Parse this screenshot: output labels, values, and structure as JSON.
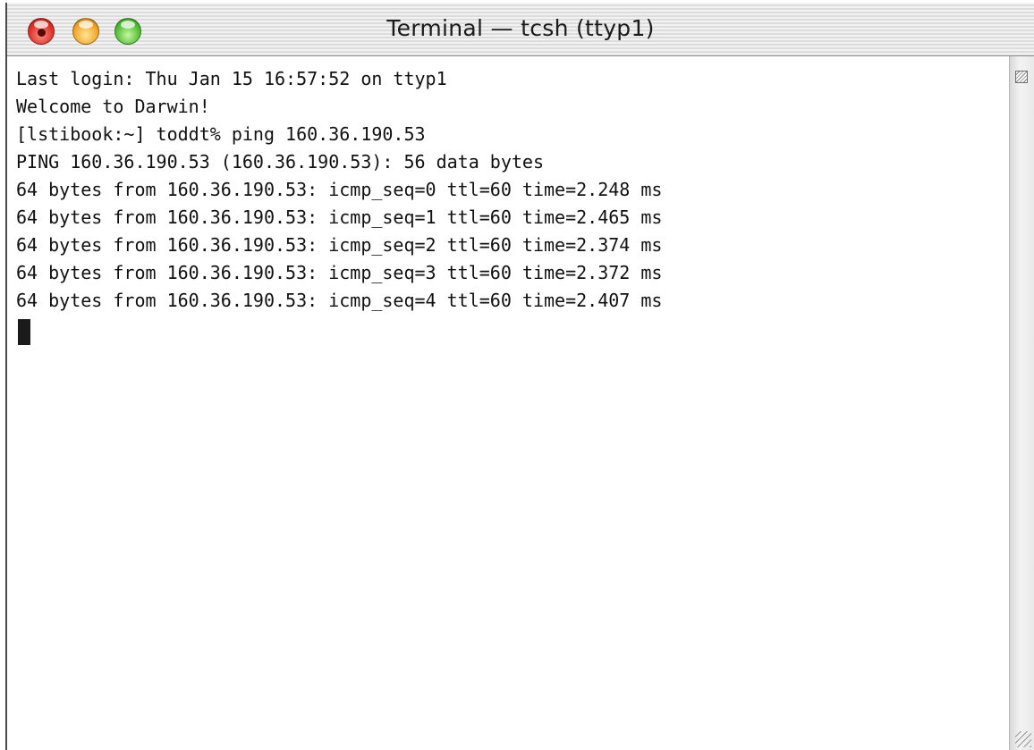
{
  "window": {
    "title": "Terminal — tcsh (ttyp1)"
  },
  "terminal": {
    "lines": [
      "Last login: Thu Jan 15 16:57:52 on ttyp1",
      "Welcome to Darwin!",
      "[lstibook:~] toddt% ping 160.36.190.53",
      "PING 160.36.190.53 (160.36.190.53): 56 data bytes",
      "64 bytes from 160.36.190.53: icmp_seq=0 ttl=60 time=2.248 ms",
      "64 bytes from 160.36.190.53: icmp_seq=1 ttl=60 time=2.465 ms",
      "64 bytes from 160.36.190.53: icmp_seq=2 ttl=60 time=2.374 ms",
      "64 bytes from 160.36.190.53: icmp_seq=3 ttl=60 time=2.372 ms",
      "64 bytes from 160.36.190.53: icmp_seq=4 ttl=60 time=2.407 ms"
    ]
  },
  "icons": {
    "close": "close-icon",
    "minimize": "minimize-icon",
    "zoom": "zoom-icon",
    "splitter": "split-pane-icon",
    "resize": "resize-grip-icon"
  },
  "colors": {
    "close": "#e0362c",
    "minimize": "#f4a92a",
    "zoom": "#57c23a",
    "text": "#111111",
    "background": "#ffffff"
  }
}
